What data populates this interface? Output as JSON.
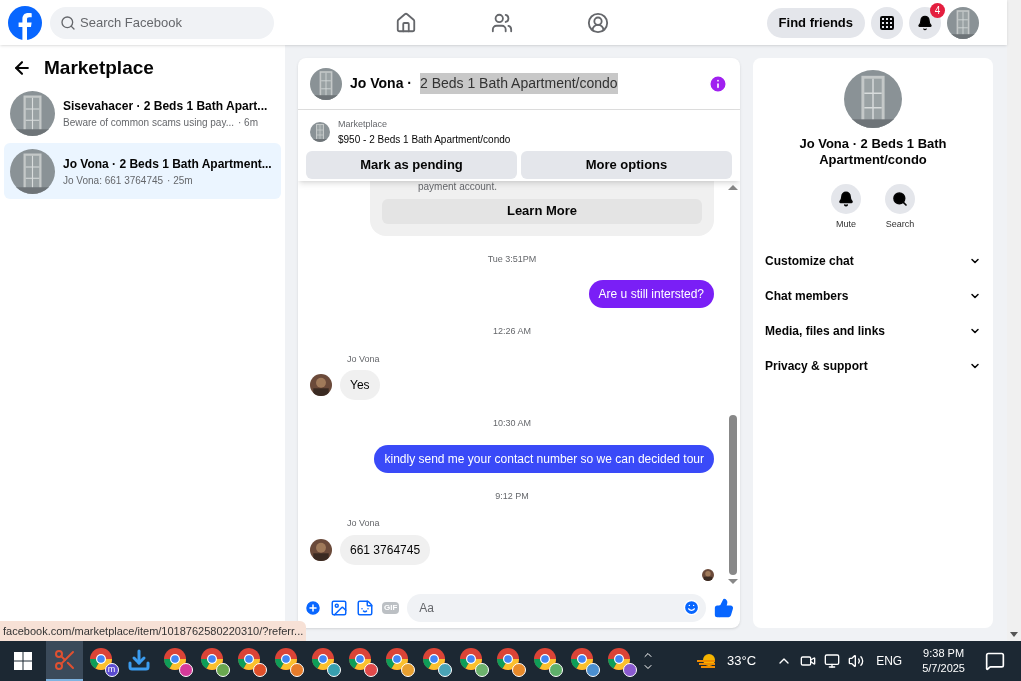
{
  "topbar": {
    "search": {
      "placeholder": "Search Facebook"
    },
    "nav": [
      {
        "kind": "home",
        "selected": false
      },
      {
        "kind": "friends",
        "selected": false
      },
      {
        "kind": "groups",
        "selected": false
      }
    ],
    "find_friends": "Find friends",
    "notification_count": "4"
  },
  "sidebar": {
    "title": "Marketplace",
    "conversations": [
      {
        "title": "Sisevahacer · 2 Beds 1 Bath Apart...",
        "preview": "Beware of common scams using pay...",
        "time": "· 6m",
        "selected": false
      },
      {
        "title": "Jo Vona · 2 Beds 1 Bath Apartment...",
        "preview": "Jo Vona: 661 3764745",
        "time": "· 25m",
        "selected": true
      }
    ]
  },
  "chat": {
    "name": "Jo Vona ·",
    "listing": "2 Beds 1 Bath Apartment/condo",
    "listing_highlighted": true,
    "item": {
      "source": "Marketplace",
      "summary": "$950 - 2 Beds 1 Bath Apartment/condo"
    },
    "actions": [
      "Mark as pending",
      "More options"
    ],
    "messages": [
      {
        "kind": "card",
        "text": "payment account.",
        "button": "Learn More"
      },
      {
        "kind": "time",
        "text": "Tue 3:51PM"
      },
      {
        "kind": "outgoing",
        "text": "Are u still intersted?",
        "color": "#7a1ff6"
      },
      {
        "kind": "time",
        "text": "12:26 AM"
      },
      {
        "kind": "incoming",
        "sender": "Jo Vona",
        "text": "Yes"
      },
      {
        "kind": "time",
        "text": "10:30 AM"
      },
      {
        "kind": "outgoing",
        "text": "kindly send me your contact number so we can decided tour",
        "color": "#3a4af8"
      },
      {
        "kind": "time",
        "text": "9:12 PM"
      },
      {
        "kind": "incoming",
        "sender": "Jo Vona",
        "text": "661 3764745"
      }
    ],
    "composer": {
      "placeholder": "Aa",
      "gif": "GIF"
    }
  },
  "details": {
    "title": "Jo Vona · 2 Beds 1 Bath Apartment/condo",
    "actions": [
      {
        "kind": "mute",
        "label": "Mute"
      },
      {
        "kind": "search",
        "label": "Search"
      }
    ],
    "sections": [
      {
        "label": "Customize chat",
        "expanded": false
      },
      {
        "label": "Chat members",
        "expanded": false
      },
      {
        "label": "Media, files and links",
        "expanded": false
      },
      {
        "label": "Privacy & support",
        "expanded": false
      }
    ]
  },
  "status_url": "facebook.com/marketplace/item/1018762580220310/?referr...",
  "taskbar": {
    "apps": [
      {
        "kind": "tool",
        "selected": true
      },
      {
        "kind": "chrome",
        "color": "#5a4bd1",
        "badge": "m",
        "selected": false
      },
      {
        "kind": "download",
        "selected": false
      },
      {
        "kind": "chrome",
        "color": "#d63a9a",
        "selected": false
      },
      {
        "kind": "chrome",
        "color": "#6aa84f",
        "selected": false
      },
      {
        "kind": "chrome",
        "color": "#e0502a",
        "selected": false
      },
      {
        "kind": "chrome",
        "color": "#e67c2a",
        "selected": false
      },
      {
        "kind": "chrome",
        "color": "#38a0b0",
        "selected": false
      },
      {
        "kind": "chrome",
        "color": "#e04a4a",
        "selected": false
      },
      {
        "kind": "chrome",
        "color": "#e8a030",
        "selected": false
      },
      {
        "kind": "chrome",
        "color": "#4aa3b5",
        "selected": false
      },
      {
        "kind": "chrome",
        "color": "#6db36d",
        "selected": false
      },
      {
        "kind": "chrome",
        "color": "#e88a2a",
        "selected": false
      },
      {
        "kind": "chrome",
        "color": "#5fb06a",
        "selected": false
      },
      {
        "kind": "chrome",
        "color": "#4a8fd0",
        "selected": false
      },
      {
        "kind": "chrome",
        "color": "#8a5ad0",
        "selected": false
      }
    ],
    "weather": "33°C",
    "language": "ENG",
    "time": "9:38 PM",
    "date": "5/7/2025"
  }
}
